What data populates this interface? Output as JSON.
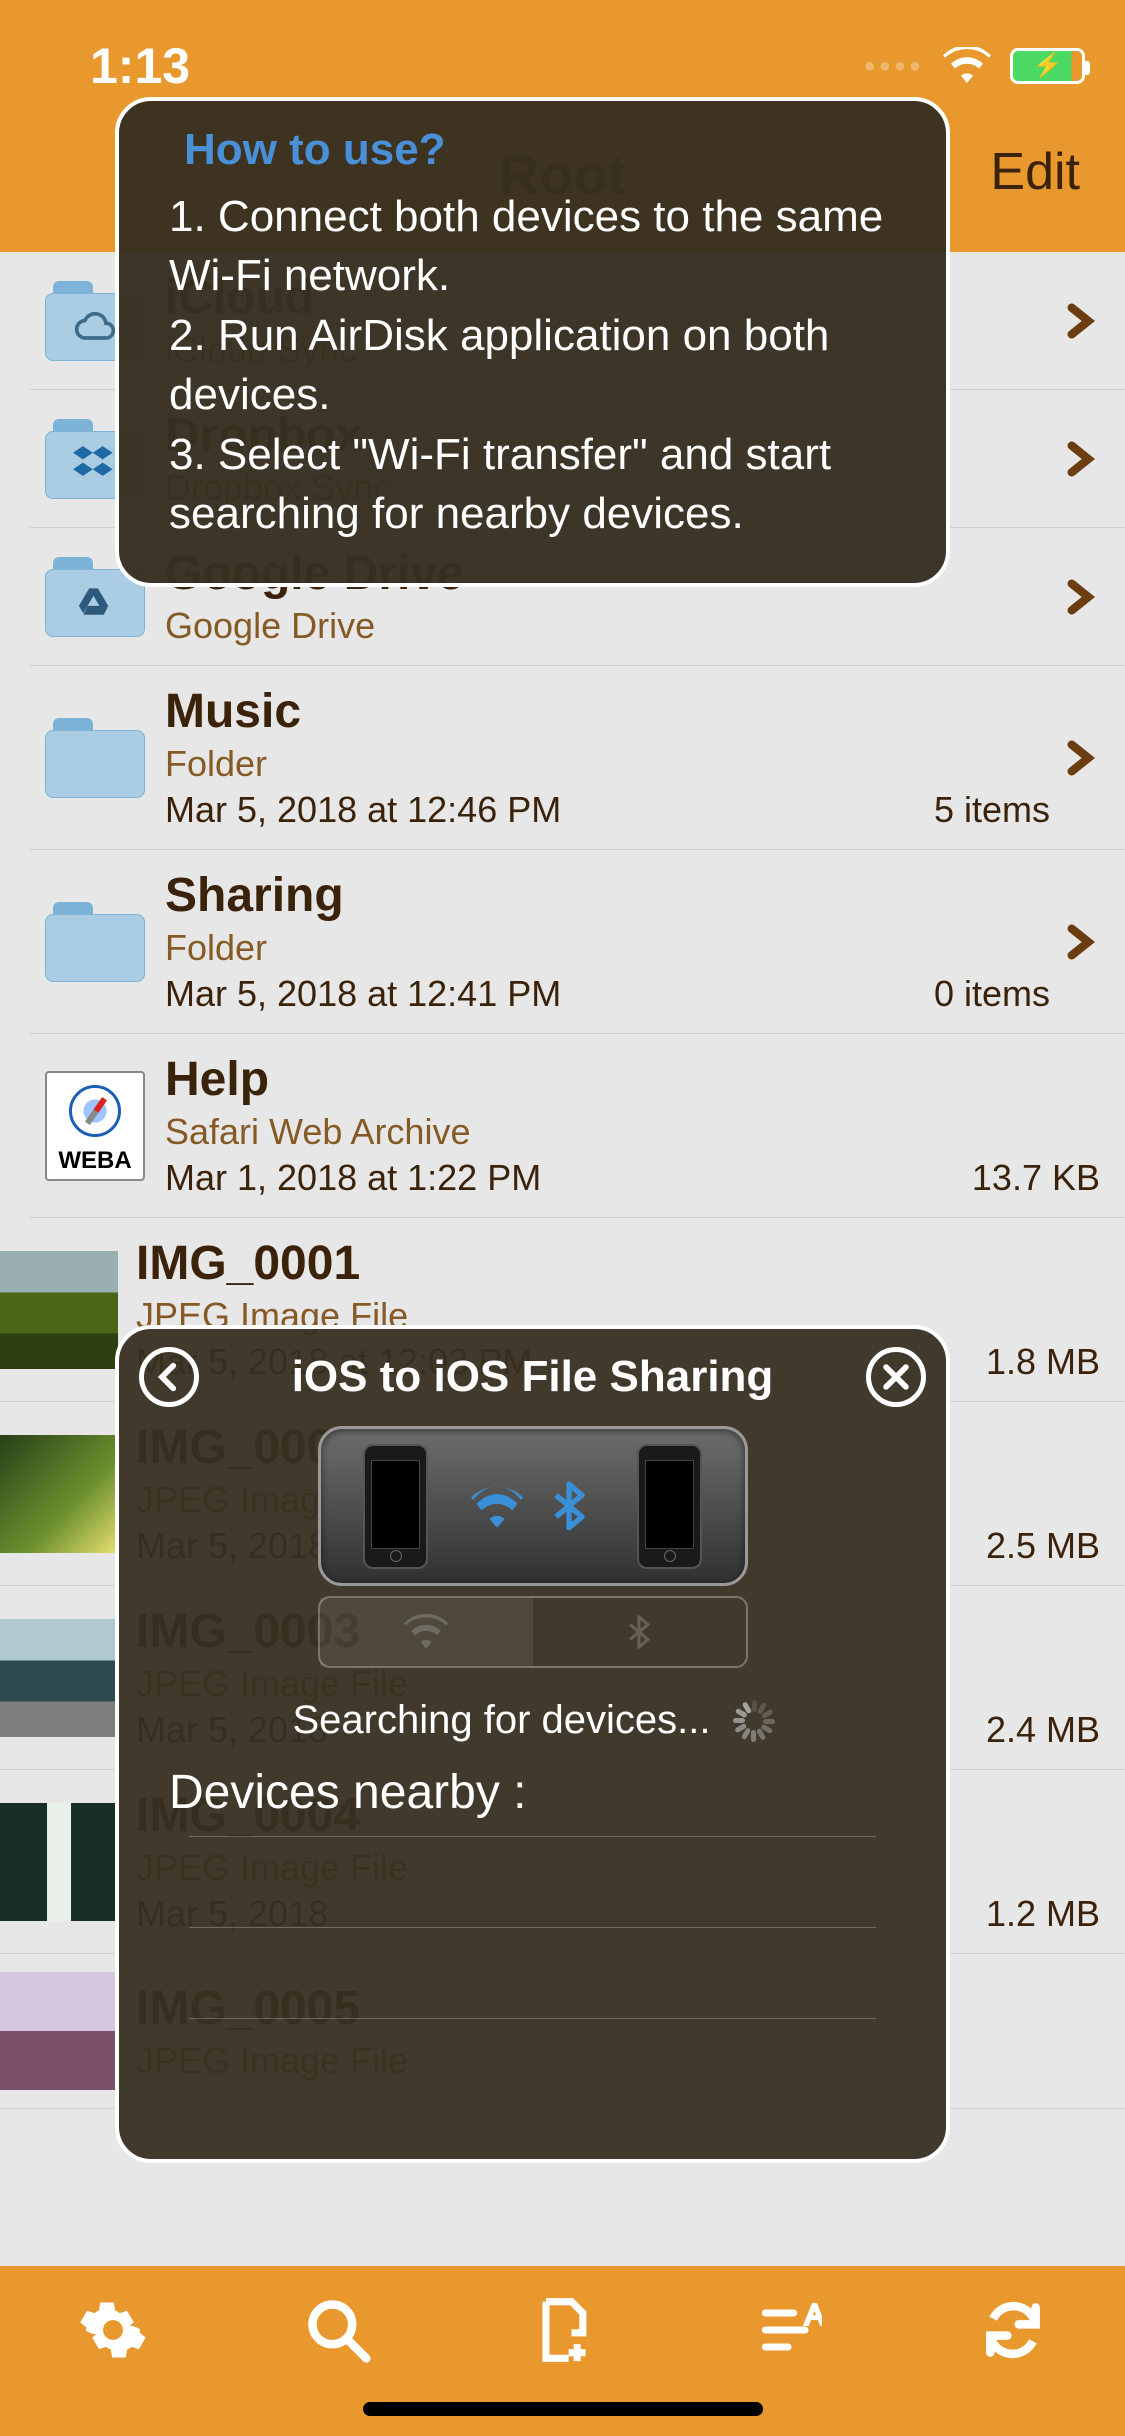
{
  "status": {
    "time": "1:13"
  },
  "nav": {
    "title": "Root",
    "edit": "Edit"
  },
  "files": [
    {
      "title": "iCloud",
      "sub": "iCloud Sync",
      "date": "",
      "size": "",
      "icon": "cloud",
      "chevron": true
    },
    {
      "title": "Dropbox",
      "sub": "Dropbox Sync",
      "date": "",
      "size": "",
      "icon": "dropbox",
      "chevron": true
    },
    {
      "title": "Google Drive",
      "sub": "Google Drive",
      "date": "",
      "size": "",
      "icon": "gdrive",
      "chevron": true
    },
    {
      "title": "Music",
      "sub": "Folder",
      "date": "Mar 5, 2018 at 12:46 PM",
      "size": "5 items",
      "icon": "folder",
      "chevron": true
    },
    {
      "title": "Sharing",
      "sub": "Folder",
      "date": "Mar 5, 2018 at 12:41 PM",
      "size": "0 items",
      "icon": "folder",
      "chevron": true
    },
    {
      "title": "Help",
      "sub": "Safari Web Archive",
      "date": "Mar 1, 2018 at 1:22 PM",
      "size": "13.7 KB",
      "icon": "webarchive",
      "chevron": false
    },
    {
      "title": "IMG_0001",
      "sub": "JPEG Image File",
      "date": "Mar 5, 2018 at 12:03 PM",
      "size": "1.8 MB",
      "icon": "th1",
      "chevron": false
    },
    {
      "title": "IMG_0002",
      "sub": "JPEG Image File",
      "date": "Mar 5, 2018",
      "size": "2.5 MB",
      "icon": "th2",
      "chevron": false
    },
    {
      "title": "IMG_0003",
      "sub": "JPEG Image File",
      "date": "Mar 5, 2018",
      "size": "2.4 MB",
      "icon": "th3",
      "chevron": false
    },
    {
      "title": "IMG_0004",
      "sub": "JPEG Image File",
      "date": "Mar 5, 2018",
      "size": "1.2 MB",
      "icon": "th4",
      "chevron": false
    },
    {
      "title": "IMG_0005",
      "sub": "JPEG Image File",
      "date": "",
      "size": "",
      "icon": "th5",
      "chevron": false
    }
  ],
  "tooltip": {
    "title": "How to use?",
    "body": "1. Connect both devices to the same Wi-Fi network.\n2. Run AirDisk application on both devices.\n3. Select \"Wi-Fi transfer\" and start searching for nearby devices."
  },
  "modal": {
    "title": "iOS to iOS File Sharing",
    "searching": "Searching for devices...",
    "devices_label": "Devices nearby :"
  },
  "webarchive_badge": "WEBA"
}
